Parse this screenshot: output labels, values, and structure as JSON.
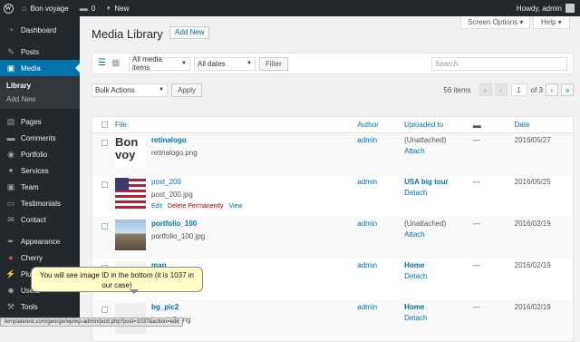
{
  "adminbar": {
    "site_name": "Bon voyage",
    "comments_count": "0",
    "new_label": "New",
    "howdy": "Howdy, admin"
  },
  "sidebar": {
    "items": [
      {
        "label": "Dashboard",
        "icon": "dashboard-icon",
        "glyph": "◔"
      },
      {
        "label": "Posts",
        "icon": "pin-icon",
        "glyph": "✎"
      },
      {
        "label": "Media",
        "icon": "media-icon",
        "glyph": "▣"
      },
      {
        "label": "Pages",
        "icon": "pages-icon",
        "glyph": "▤"
      },
      {
        "label": "Comments",
        "icon": "comments-icon",
        "glyph": "▬"
      },
      {
        "label": "Portfolio",
        "icon": "portfolio-icon",
        "glyph": "◉"
      },
      {
        "label": "Services",
        "icon": "services-icon",
        "glyph": "✦"
      },
      {
        "label": "Team",
        "icon": "team-icon",
        "glyph": "▣"
      },
      {
        "label": "Testimonials",
        "icon": "testimonials-icon",
        "glyph": "▭"
      },
      {
        "label": "Contact",
        "icon": "contact-icon",
        "glyph": "✉"
      },
      {
        "label": "Appearance",
        "icon": "appearance-icon",
        "glyph": "✒"
      },
      {
        "label": "Cherry",
        "icon": "cherry-icon",
        "glyph": "●"
      },
      {
        "label": "Plugins",
        "icon": "plugins-icon",
        "glyph": "⚡"
      },
      {
        "label": "Users",
        "icon": "users-icon",
        "glyph": "☻"
      },
      {
        "label": "Tools",
        "icon": "tools-icon",
        "glyph": "⚒"
      }
    ],
    "submenu": [
      "Library",
      "Add New"
    ]
  },
  "header": {
    "title": "Media Library",
    "add_new": "Add New",
    "screen_options": "Screen Options ▾",
    "help": "Help ▾"
  },
  "filters": {
    "type": "All media items",
    "dates": "All dates",
    "filter_btn": "Filter",
    "search_placeholder": "Search"
  },
  "bulk": {
    "action": "Bulk Actions",
    "apply": "Apply",
    "items_count": "56 items",
    "page": "1",
    "of_pages": "of 3"
  },
  "table": {
    "headers": {
      "file": "File",
      "author": "Author",
      "uploaded_to": "Uploaded to",
      "date": "Date"
    },
    "rows": [
      {
        "title": "retinalogo",
        "filename": "retinalogo.png",
        "author": "admin",
        "uploaded": "(Unattached)",
        "action": "Attach",
        "comments": "—",
        "date": "2016/05/27",
        "thumb": "logo"
      },
      {
        "title": "post_200",
        "filename": "post_200.jpg",
        "author": "admin",
        "uploaded": "USA big tour",
        "action": "Detach",
        "comments": "—",
        "date": "2016/05/25",
        "thumb": "flag",
        "row_actions": {
          "edit": "Edit",
          "delete": "Delete Permanently",
          "view": "View"
        }
      },
      {
        "title": "portfolio_100",
        "filename": "portfolio_100.jpg",
        "author": "admin",
        "uploaded": "(Unattached)",
        "action": "Attach",
        "comments": "—",
        "date": "2016/02/19",
        "thumb": "pier"
      },
      {
        "title": "map",
        "filename": "map.png",
        "author": "admin",
        "uploaded": "Home",
        "action": "Detach",
        "comments": "—",
        "date": "2016/02/19",
        "thumb": "map"
      },
      {
        "title": "bg_pic2",
        "filename": "bg_pic2.png",
        "author": "admin",
        "uploaded": "Home",
        "action": "Detach",
        "comments": "—",
        "date": "2016/02/19",
        "thumb": "bg"
      }
    ]
  },
  "tooltip": "You will see image ID in the bottom (it is 1037 in our case)",
  "statusbar": "templatetest.com/george/wp/wp-admin/post.php?post=1037&action=edit",
  "colors": {
    "accent": "#0073aa",
    "adminbar": "#23282d",
    "delete": "#aa0000"
  }
}
